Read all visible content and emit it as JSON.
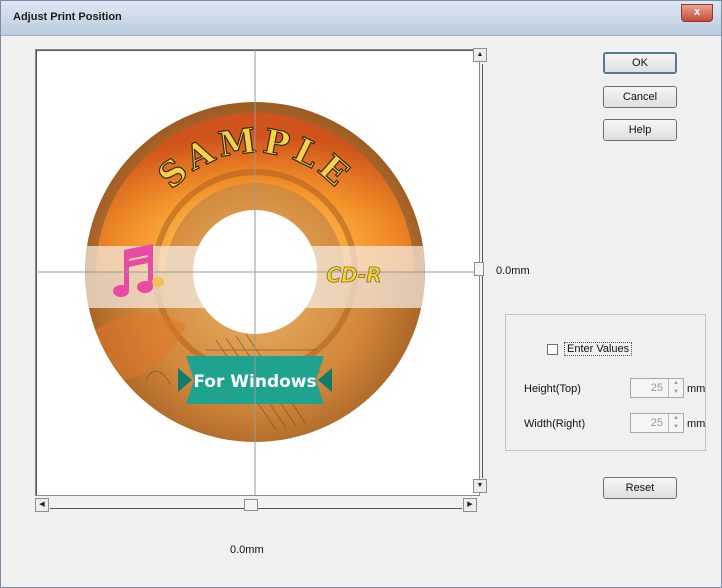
{
  "window": {
    "title": "Adjust Print Position",
    "close_label": "x"
  },
  "buttons": {
    "ok": "OK",
    "cancel": "Cancel",
    "help": "Help",
    "reset": "Reset"
  },
  "position": {
    "vertical_readout": "0.0mm",
    "horizontal_readout": "0.0mm"
  },
  "manual": {
    "enter_values_label": "Enter Values",
    "enter_values_checked": false,
    "height_label": "Height(Top)",
    "height_value": "25",
    "width_label": "Width(Right)",
    "width_value": "25",
    "unit": "mm"
  },
  "disc": {
    "title_text": "SAMPLE",
    "banner_text": "For Windows",
    "disc_type_text": "CD-R"
  },
  "colors": {
    "disc_orange": "#d98a2e",
    "banner_teal": "#1fa38f",
    "title_yellow": "#f3d14a"
  }
}
